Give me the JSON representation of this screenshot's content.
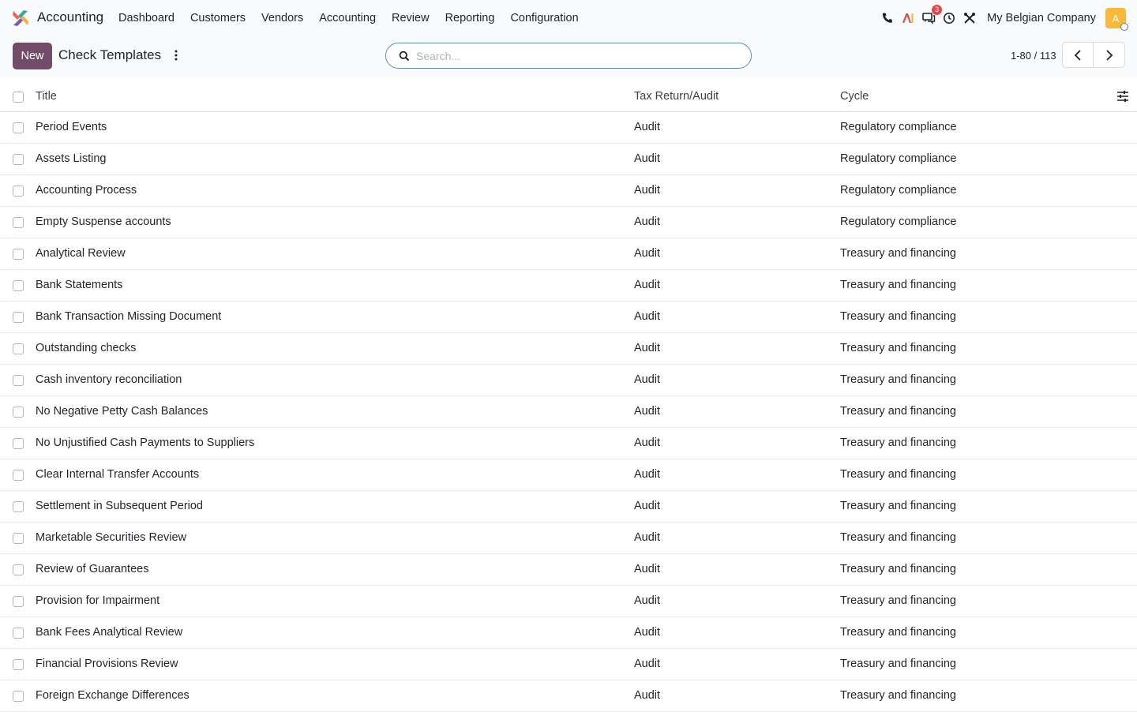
{
  "navbar": {
    "app_name": "Accounting",
    "menu": [
      "Dashboard",
      "Customers",
      "Vendors",
      "Accounting",
      "Review",
      "Reporting",
      "Configuration"
    ],
    "messages_badge": "3",
    "company": "My Belgian Company",
    "avatar_letter": "A",
    "icons": [
      "phone-icon",
      "ai-icon",
      "messages-icon",
      "clock-icon",
      "tools-icon"
    ]
  },
  "control": {
    "new_label": "New",
    "title": "Check Templates",
    "search_placeholder": "Search...",
    "pager": "1-80 / 113"
  },
  "table": {
    "headers": {
      "title": "Title",
      "type": "Tax Return/Audit",
      "cycle": "Cycle"
    },
    "rows": [
      {
        "title": "Period Events",
        "type": "Audit",
        "cycle": "Regulatory compliance"
      },
      {
        "title": "Assets Listing",
        "type": "Audit",
        "cycle": "Regulatory compliance"
      },
      {
        "title": "Accounting Process",
        "type": "Audit",
        "cycle": "Regulatory compliance"
      },
      {
        "title": "Empty Suspense accounts",
        "type": "Audit",
        "cycle": "Regulatory compliance"
      },
      {
        "title": "Analytical Review",
        "type": "Audit",
        "cycle": "Treasury and financing"
      },
      {
        "title": "Bank Statements",
        "type": "Audit",
        "cycle": "Treasury and financing"
      },
      {
        "title": "Bank Transaction Missing Document",
        "type": "Audit",
        "cycle": "Treasury and financing"
      },
      {
        "title": "Outstanding checks",
        "type": "Audit",
        "cycle": "Treasury and financing"
      },
      {
        "title": "Cash inventory reconciliation",
        "type": "Audit",
        "cycle": "Treasury and financing"
      },
      {
        "title": "No Negative Petty Cash Balances",
        "type": "Audit",
        "cycle": "Treasury and financing"
      },
      {
        "title": "No Unjustified Cash Payments to Suppliers",
        "type": "Audit",
        "cycle": "Treasury and financing"
      },
      {
        "title": "Clear Internal Transfer Accounts",
        "type": "Audit",
        "cycle": "Treasury and financing"
      },
      {
        "title": "Settlement in Subsequent Period",
        "type": "Audit",
        "cycle": "Treasury and financing"
      },
      {
        "title": "Marketable Securities Review",
        "type": "Audit",
        "cycle": "Treasury and financing"
      },
      {
        "title": "Review of Guarantees",
        "type": "Audit",
        "cycle": "Treasury and financing"
      },
      {
        "title": "Provision for Impairment",
        "type": "Audit",
        "cycle": "Treasury and financing"
      },
      {
        "title": "Bank Fees Analytical Review",
        "type": "Audit",
        "cycle": "Treasury and financing"
      },
      {
        "title": "Financial Provisions Review",
        "type": "Audit",
        "cycle": "Treasury and financing"
      },
      {
        "title": "Foreign Exchange Differences",
        "type": "Audit",
        "cycle": "Treasury and financing"
      }
    ]
  },
  "colors": {
    "brand": "#714b67",
    "search_border": "#5a8fa0",
    "badge": "#e0484a",
    "avatar": "#f6b93b"
  }
}
